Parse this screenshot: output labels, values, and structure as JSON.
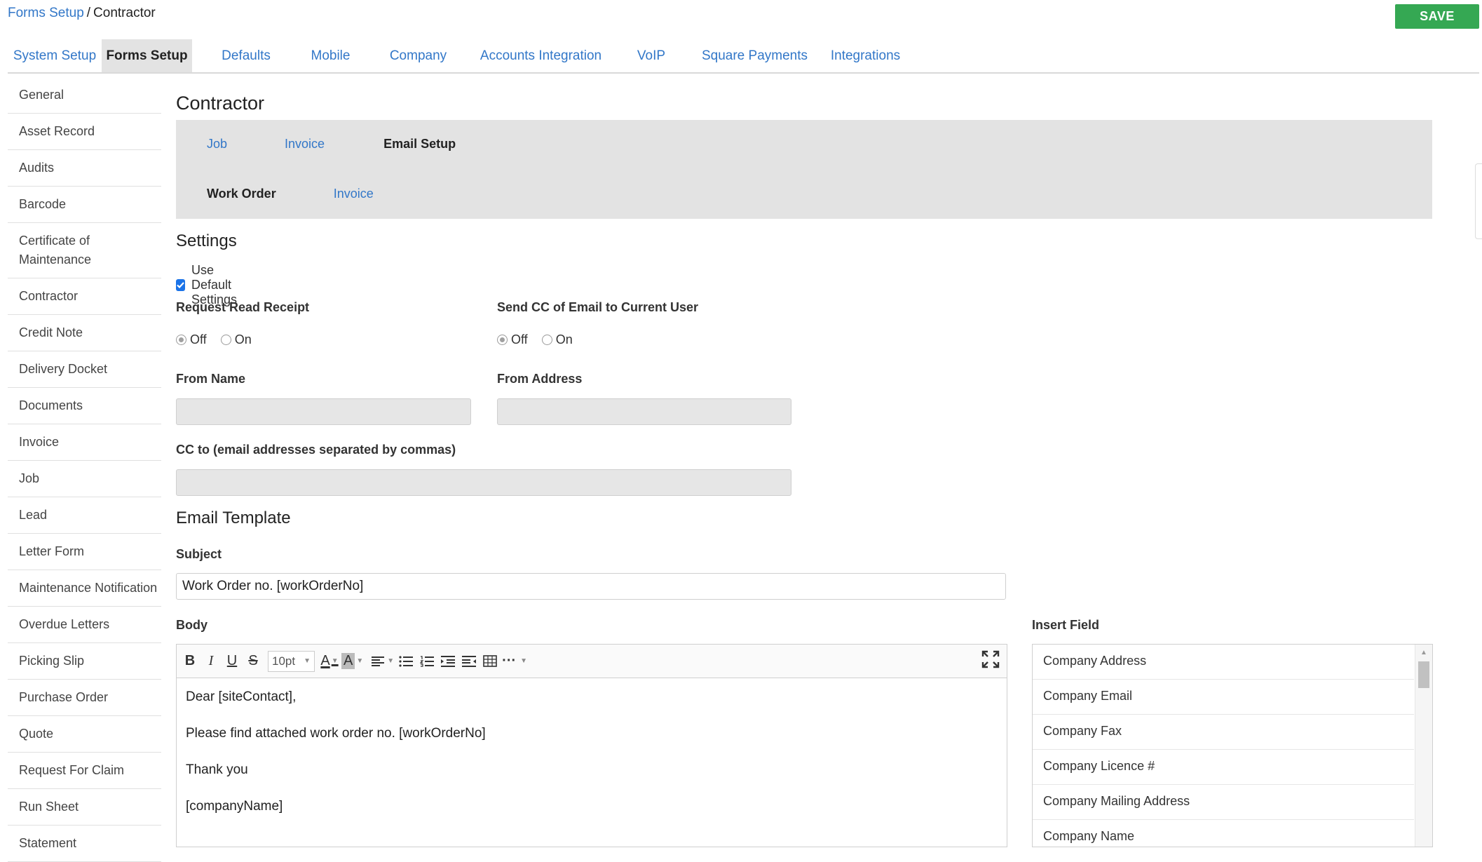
{
  "breadcrumb": {
    "parent": "Forms Setup",
    "separator": "/",
    "current": "Contractor"
  },
  "toolbar": {
    "save_label": "SAVE"
  },
  "top_tabs": [
    {
      "label": "System Setup",
      "active": false
    },
    {
      "label": "Forms Setup",
      "active": true
    },
    {
      "label": "Defaults",
      "active": false
    },
    {
      "label": "Mobile",
      "active": false
    },
    {
      "label": "Company",
      "active": false
    },
    {
      "label": "Accounts Integration",
      "active": false
    },
    {
      "label": "VoIP",
      "active": false
    },
    {
      "label": "Square Payments",
      "active": false
    },
    {
      "label": "Integrations",
      "active": false
    }
  ],
  "sidebar": {
    "items": [
      "General",
      "Asset Record",
      "Audits",
      "Barcode",
      "Certificate of Maintenance",
      "Contractor",
      "Credit Note",
      "Delivery Docket",
      "Documents",
      "Invoice",
      "Job",
      "Lead",
      "Letter Form",
      "Maintenance Notification",
      "Overdue Letters",
      "Picking Slip",
      "Purchase Order",
      "Quote",
      "Request For Claim",
      "Run Sheet",
      "Statement"
    ]
  },
  "page": {
    "title": "Contractor"
  },
  "subnav": {
    "row1": [
      {
        "label": "Job",
        "active": false
      },
      {
        "label": "Invoice",
        "active": false
      },
      {
        "label": "Email Setup",
        "active": true
      }
    ],
    "row2": [
      {
        "label": "Work Order",
        "active": true
      },
      {
        "label": "Invoice",
        "active": false
      }
    ]
  },
  "settings": {
    "title": "Settings",
    "use_default_label": "Use Default Settings",
    "use_default_checked": true,
    "read_receipt": {
      "label": "Request Read Receipt",
      "off": "Off",
      "on": "On",
      "selected": "Off"
    },
    "send_cc": {
      "label": "Send CC of Email to Current User",
      "off": "Off",
      "on": "On",
      "selected": "Off"
    },
    "from_name": {
      "label": "From Name",
      "value": ""
    },
    "from_address": {
      "label": "From Address",
      "value": ""
    },
    "cc_to": {
      "label": "CC to (email addresses separated by commas)",
      "value": ""
    }
  },
  "template": {
    "title": "Email Template",
    "subject_label": "Subject",
    "subject_value": "Work Order no. [workOrderNo]",
    "body_label": "Body",
    "font_size": "10pt",
    "body_lines": [
      "Dear [siteContact],",
      "Please find attached work order no. [workOrderNo]",
      "Thank you",
      "[companyName]"
    ]
  },
  "insert_field": {
    "label": "Insert Field",
    "items": [
      "Company Address",
      "Company Email",
      "Company Fax",
      "Company Licence #",
      "Company Mailing Address",
      "Company Name"
    ]
  },
  "colors": {
    "accent": "#3277c8",
    "save": "#35a853",
    "active_tab_bg": "#e3e3e3",
    "checkbox": "#1a73e8"
  }
}
